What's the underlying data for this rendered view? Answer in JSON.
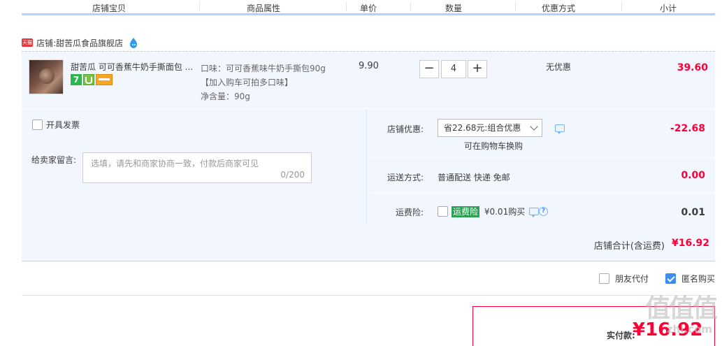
{
  "header": {
    "columns": [
      "店铺宝贝",
      "商品属性",
      "单价",
      "数量",
      "优惠方式",
      "小计"
    ]
  },
  "shop": {
    "badge": "天猫",
    "label": "店铺:",
    "name": "甜苦瓜食品旗舰店"
  },
  "item": {
    "title": "甜苦瓜 可可香蕉牛奶手撕面包 ...",
    "badge_seven": "7",
    "props": [
      "口味：可可香蕉味牛奶手撕包90g",
      "【加入购车可拍多口味】",
      "净含量：90g"
    ],
    "price": "9.90",
    "minus": "−",
    "quantity": "4",
    "plus": "+",
    "promo": "无优惠",
    "subtotal": "39.60"
  },
  "options": {
    "invoice_label": "开具发票",
    "message_label": "给卖家留言:",
    "message_placeholder": "选填，请先和商家协商一致，付款后商家可见",
    "message_count": "0/200",
    "discount_label": "店铺优惠:",
    "discount_select": "省22.68元:组合优惠",
    "discount_hint": "可在购物车换购",
    "discount_value": "-22.68",
    "shipping_label": "运送方式:",
    "shipping_method": "普通配送 快递 免邮",
    "shipping_value": "0.00",
    "insurance_label": "运费险:",
    "insurance_badge": "运费险",
    "insurance_price": "¥0.01购买",
    "help_glyph": "?",
    "insurance_value": "0.01"
  },
  "shop_total": {
    "label": "店铺合计(含运费)",
    "value": "¥16.92"
  },
  "agents": {
    "friend_pay": "朋友代付",
    "anonymous": "匿名购买"
  },
  "payment": {
    "label": "实付款:",
    "value": "¥16.92"
  },
  "watermark": {
    "main": "值值值",
    "sub": "zhi.com"
  },
  "colors": {
    "accent": "#ff0036",
    "border_blue": "#b2d1ff",
    "row_bg": "#f2f7ff",
    "checkbox_blue": "#3d8cf0"
  }
}
